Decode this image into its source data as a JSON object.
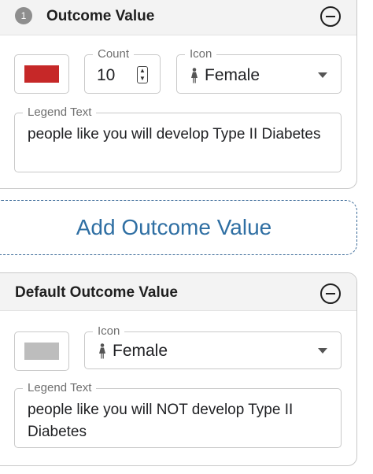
{
  "outcome_card": {
    "number": "1",
    "title": "Outcome Value",
    "swatch_color": "#c62828",
    "count_label": "Count",
    "count_value": "10",
    "icon_label": "Icon",
    "icon_value": "Female",
    "icon_name": "female-person-icon",
    "legend_label": "Legend Text",
    "legend_text": "people like you will develop Type II Diabetes"
  },
  "add_button": {
    "label": "Add Outcome Value"
  },
  "default_card": {
    "title": "Default Outcome Value",
    "swatch_color": "#bdbdbd",
    "icon_label": "Icon",
    "icon_value": "Female",
    "icon_name": "female-person-icon",
    "legend_label": "Legend Text",
    "legend_text": "people like you will NOT develop Type II Diabetes"
  }
}
